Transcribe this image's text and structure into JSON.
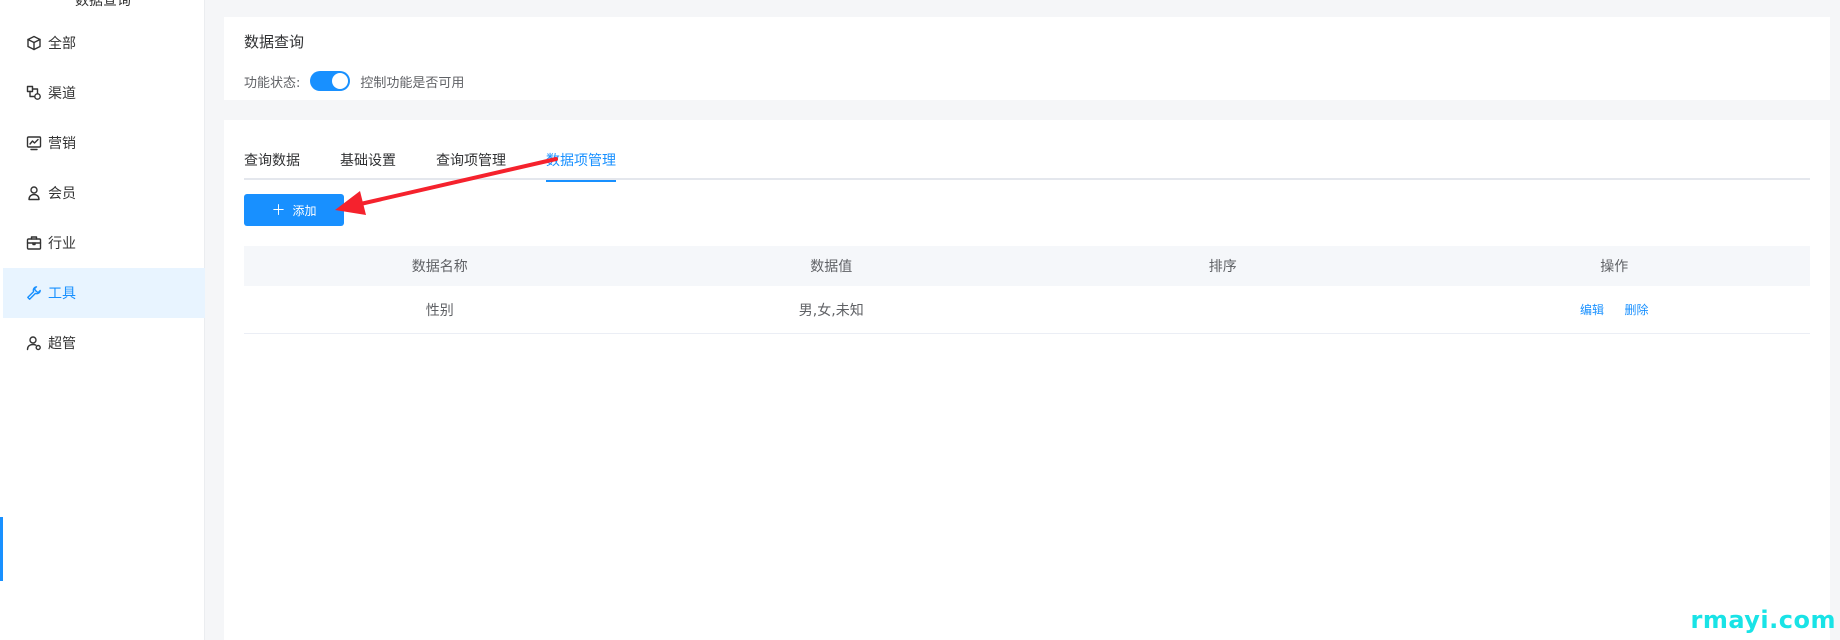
{
  "sidebar": {
    "cut_title": "数据查询",
    "items": [
      {
        "label": "全部",
        "icon": "cube-icon"
      },
      {
        "label": "渠道",
        "icon": "channel-icon"
      },
      {
        "label": "营销",
        "icon": "chart-monitor-icon"
      },
      {
        "label": "会员",
        "icon": "user-icon"
      },
      {
        "label": "行业",
        "icon": "briefcase-icon"
      },
      {
        "label": "工具",
        "icon": "wrench-icon",
        "active": true
      },
      {
        "label": "超管",
        "icon": "admin-user-icon"
      }
    ]
  },
  "feature": {
    "title": "数据查询",
    "status_label": "功能状态:",
    "status_hint": "控制功能是否可用",
    "enabled": true
  },
  "tabs": [
    {
      "label": "查询数据"
    },
    {
      "label": "基础设置"
    },
    {
      "label": "查询项管理"
    },
    {
      "label": "数据项管理",
      "active": true
    }
  ],
  "add_button": {
    "label": "添加",
    "icon": "plus-icon"
  },
  "table": {
    "columns": [
      "数据名称",
      "数据值",
      "排序",
      "操作"
    ],
    "rows": [
      {
        "name": "性别",
        "value": "男,女,未知",
        "sort": "",
        "actions": [
          "编辑",
          "删除"
        ]
      }
    ]
  },
  "annotation": {
    "color": "#f5222d",
    "shape": "red-arrow"
  },
  "watermark": "rmayi.com",
  "colors": {
    "accent": "#1890ff",
    "active_bg": "#e8f4ff",
    "watermark": "#19e3e6"
  }
}
